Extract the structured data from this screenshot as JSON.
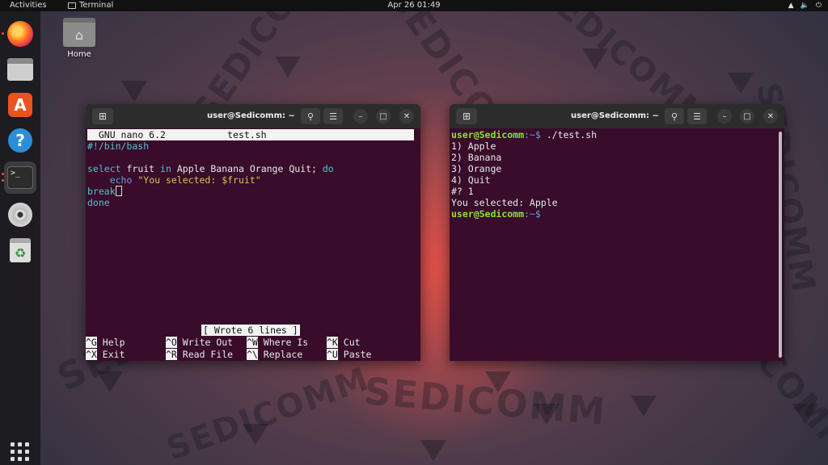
{
  "topbar": {
    "activities": "Activities",
    "app_name": "Terminal",
    "clock": "Apr 26  01:49",
    "tray": [
      "network-icon",
      "volume-icon",
      "power-icon"
    ]
  },
  "desktop": {
    "home_label": "Home",
    "watermark": "SEDICOMM"
  },
  "dock": {
    "items": [
      "Firefox",
      "Files",
      "Ubuntu Software",
      "Help",
      "Terminal",
      "Disc",
      "Trash"
    ],
    "accent": "#e95420"
  },
  "left_window": {
    "title": "user@Sedicomm: ~",
    "nano_header_app": "GNU nano 6.2",
    "nano_header_file": "test.sh",
    "code": {
      "l1": "#!/bin/bash",
      "l3_kw1": "select",
      "l3_var": "fruit",
      "l3_kw2": "in",
      "l3_rest": "Apple Banana Orange Quit;",
      "l3_kw3": "do",
      "l4_cmd": "echo",
      "l4_str": "\"You selected: $fruit\"",
      "l5": "break",
      "l6": "done"
    },
    "status_message": "[ Wrote 6 lines ]",
    "shortcuts": [
      {
        "key": "^G",
        "label": "Help"
      },
      {
        "key": "^O",
        "label": "Write Out"
      },
      {
        "key": "^W",
        "label": "Where Is"
      },
      {
        "key": "^K",
        "label": "Cut"
      },
      {
        "key": "^X",
        "label": "Exit"
      },
      {
        "key": "^R",
        "label": "Read File"
      },
      {
        "key": "^\\",
        "label": "Replace"
      },
      {
        "key": "^U",
        "label": "Paste"
      }
    ]
  },
  "right_window": {
    "title": "user@Sedicomm: ~",
    "prompt_user": "user@Sedicomm",
    "prompt_path": ":~$ ",
    "command": "./test.sh",
    "output": [
      "1) Apple",
      "2) Banana",
      "3) Orange",
      "4) Quit",
      "#? 1",
      "You selected: Apple"
    ]
  },
  "colors": {
    "terminal_bg": "#380c2a",
    "titlebar_bg": "#2c2c2c",
    "prompt_green": "#8ae234"
  }
}
